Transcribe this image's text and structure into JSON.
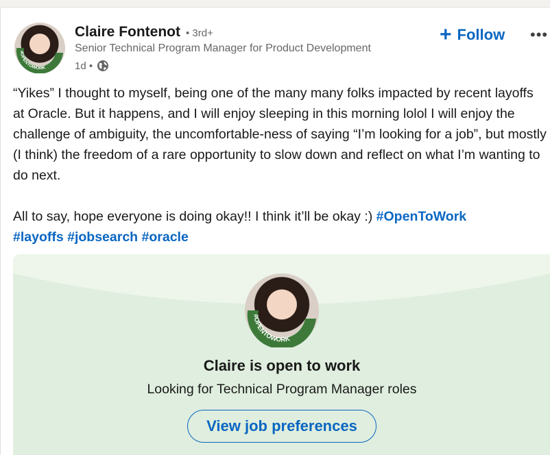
{
  "post": {
    "author": {
      "name": "Claire Fontenot",
      "degree": "• 3rd+",
      "headline": "Senior Technical Program Manager for Product Development",
      "time": "1d •",
      "badge_text": "#OPENTOWORK"
    },
    "follow_label": "Follow",
    "follow_icon": "+",
    "more_label": "•••",
    "body": {
      "paragraph1": "“Yikes” I thought to myself, being one of the many many folks impacted by recent layoffs at Oracle. But it happens, and I will enjoy sleeping in this morning lolol I will enjoy the challenge of ambiguity, the uncomfortable-ness of saying “I’m looking for a job”, but mostly (I think) the freedom of a rare opportunity to slow down and reflect on what I’m wanting to do next.",
      "paragraph2_text": "All to say, hope everyone is doing okay!! I think it’ll be okay :) ",
      "hashtags": [
        "#OpenToWork",
        "#layoffs",
        "#jobsearch",
        "#oracle"
      ]
    }
  },
  "open_to_work": {
    "title": "Claire is open to work",
    "subtitle": "Looking for Technical Program Manager roles",
    "button_label": "View job preferences"
  },
  "colors": {
    "accent": "#0a66c2",
    "otw_green": "#3d7a3a",
    "card_bg": "#dfeede"
  }
}
